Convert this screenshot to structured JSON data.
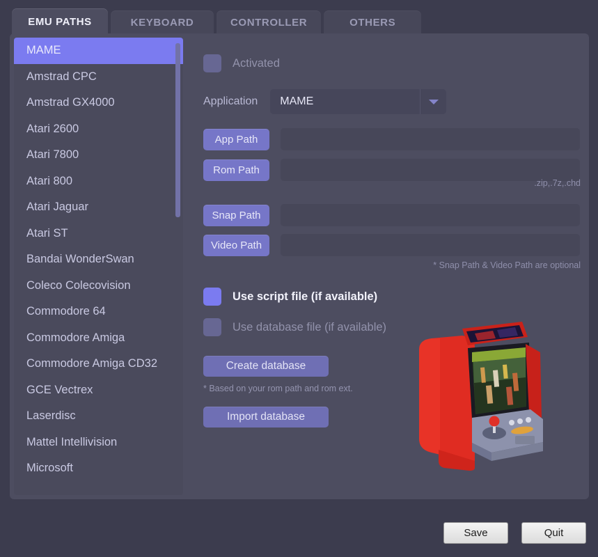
{
  "tabs": [
    {
      "label": "EMU PATHS",
      "active": true
    },
    {
      "label": "KEYBOARD",
      "active": false
    },
    {
      "label": "CONTROLLER",
      "active": false
    },
    {
      "label": "OTHERS",
      "active": false
    }
  ],
  "systems": {
    "selected": "MAME",
    "items": [
      "MAME",
      "Amstrad CPC",
      "Amstrad GX4000",
      "Atari 2600",
      "Atari 7800",
      "Atari 800",
      "Atari Jaguar",
      "Atari ST",
      "Bandai WonderSwan",
      "Coleco Colecovision",
      "Commodore 64",
      "Commodore Amiga",
      "Commodore Amiga CD32",
      "GCE Vectrex",
      "Laserdisc",
      "Mattel Intellivision",
      "Microsoft"
    ]
  },
  "form": {
    "activated_label": "Activated",
    "activated_checked": false,
    "application_label": "Application",
    "application_value": "MAME",
    "app_path_button": "App Path",
    "app_path_value": "",
    "rom_path_button": "Rom Path",
    "rom_path_value": "",
    "rom_ext_hint": ".zip,.7z,.chd",
    "snap_path_button": "Snap Path",
    "snap_path_value": "",
    "video_path_button": "Video Path",
    "video_path_value": "",
    "optional_hint": "* Snap Path & Video Path are optional",
    "use_script_label": "Use script file (if available)",
    "use_script_checked": true,
    "use_database_label": "Use database file (if available)",
    "use_database_checked": false,
    "create_database_button": "Create database",
    "create_database_hint": "* Based on your rom path and rom ext.",
    "import_database_button": "Import database"
  },
  "footer": {
    "save_label": "Save",
    "quit_label": "Quit"
  },
  "colors": {
    "accent": "#7b7bf0",
    "panel": "#4d4d60",
    "window": "#3c3c4e",
    "field": "#474759",
    "button": "#7676c8",
    "cabinet_red": "#e02c22"
  }
}
